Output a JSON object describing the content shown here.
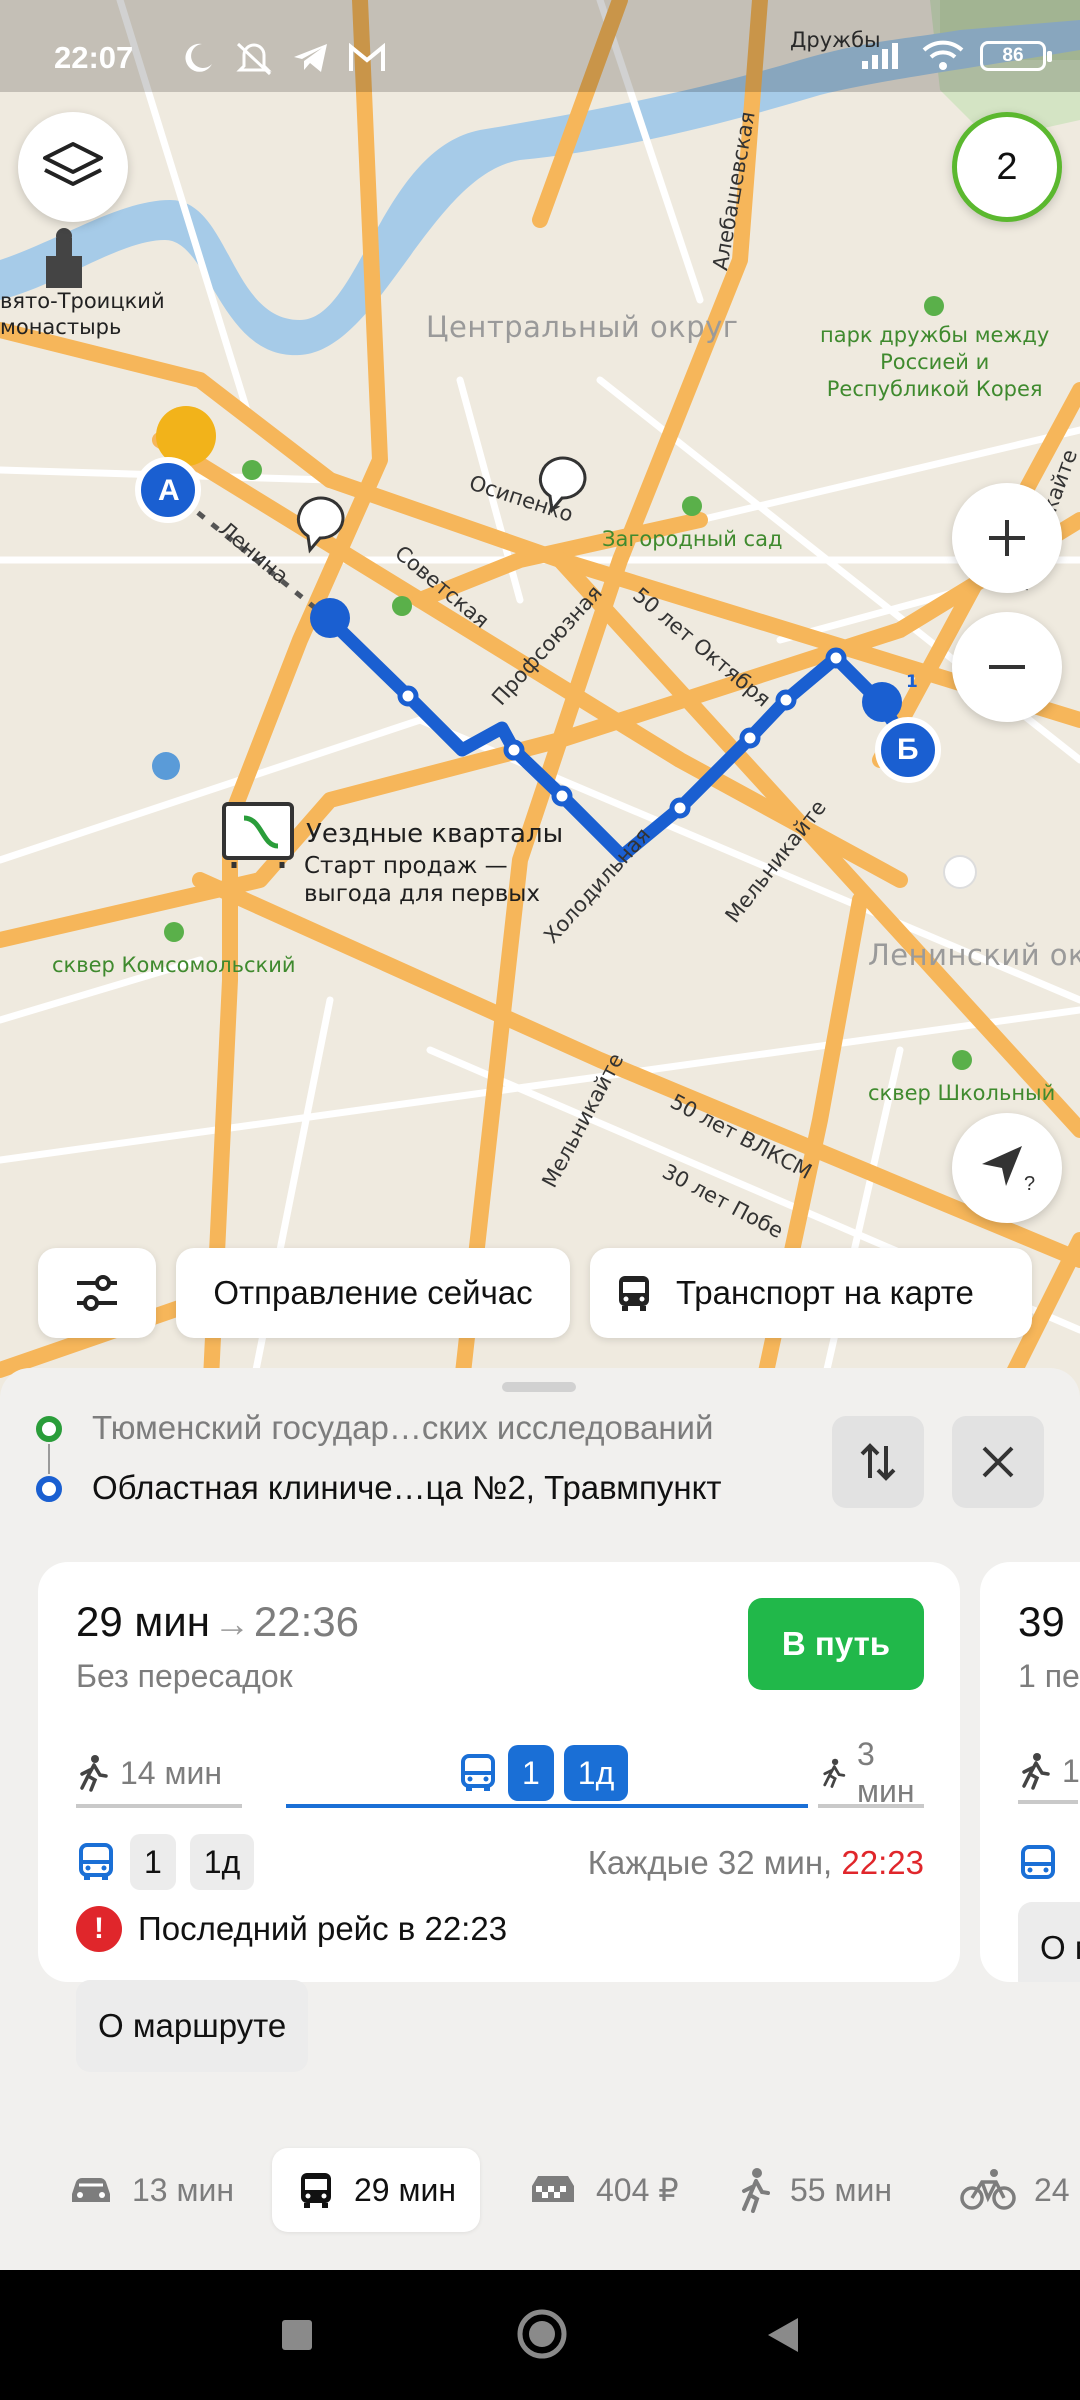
{
  "status_bar": {
    "time": "22:07",
    "battery": "86",
    "left_icons": [
      "moon-icon",
      "bell-off-icon",
      "telegram-icon",
      "gmail-icon"
    ],
    "right_icons": [
      "signal-icon",
      "wifi-icon",
      "battery-icon"
    ]
  },
  "map": {
    "district_labels": [
      "Центральный округ",
      "Ленинский окр"
    ],
    "park_labels": [
      "парк дружбы между\nРоссией и\nРеспубликой Корея",
      "Загородный сад",
      "сквер Комсомольский",
      "сквер Школьный"
    ],
    "poi": {
      "monastery": "вято-Троицкий\nмонастырь",
      "promo_title": "Уездные кварталы",
      "promo_text": "Старт продаж —\nвыгода для первых"
    },
    "streets": [
      "Дружбы",
      "Алебашевская",
      "Осипенко",
      "Ленина",
      "Советская",
      "Профсоюзная",
      "50 лет Октября",
      "Холодильная",
      "Мельникайте",
      "Мельникайте",
      "50 лет ВЛКСМ",
      "30 лет Побе",
      "Мельникайте"
    ],
    "marker_a": "А",
    "marker_b": "Б",
    "stop_badge": "1",
    "counter": "2",
    "colors": {
      "route": "#1a5fd1",
      "road": "#f6b65a",
      "water": "#a6cbe8",
      "park": "#3f8a2e"
    }
  },
  "chips": {
    "filter_icon": "sliders-icon",
    "departure": "Отправление сейчас",
    "transport": "Транспорт на карте"
  },
  "route": {
    "from": "Тюменский государ…ских исследований",
    "to": "Областная клиниче…ца №2, Травмпункт"
  },
  "card": {
    "duration": "29 мин",
    "arrow": "→",
    "arrival": "22:36",
    "transfers": "Без пересадок",
    "go_button": "В путь",
    "walk_start": "14 мин",
    "bus_routes": [
      "1",
      "1д"
    ],
    "walk_end": "3 мин",
    "frequency_prefix": "Каждые 32 мин, ",
    "last_departure": "22:23",
    "warning": "Последний рейс в 22:23",
    "warning_mark": "!",
    "about_button": "О маршруте"
  },
  "card_next": {
    "duration": "39",
    "transfers": "1 пе",
    "walk": "1",
    "about_fragment": "О м"
  },
  "modes": [
    {
      "icon": "car-icon",
      "label": "13 мин"
    },
    {
      "icon": "bus-icon",
      "label": "29 мин",
      "active": true
    },
    {
      "icon": "taxi-icon",
      "label": "404 ₽"
    },
    {
      "icon": "walk-icon",
      "label": "55 мин"
    },
    {
      "icon": "bike-icon",
      "label": "24"
    }
  ]
}
